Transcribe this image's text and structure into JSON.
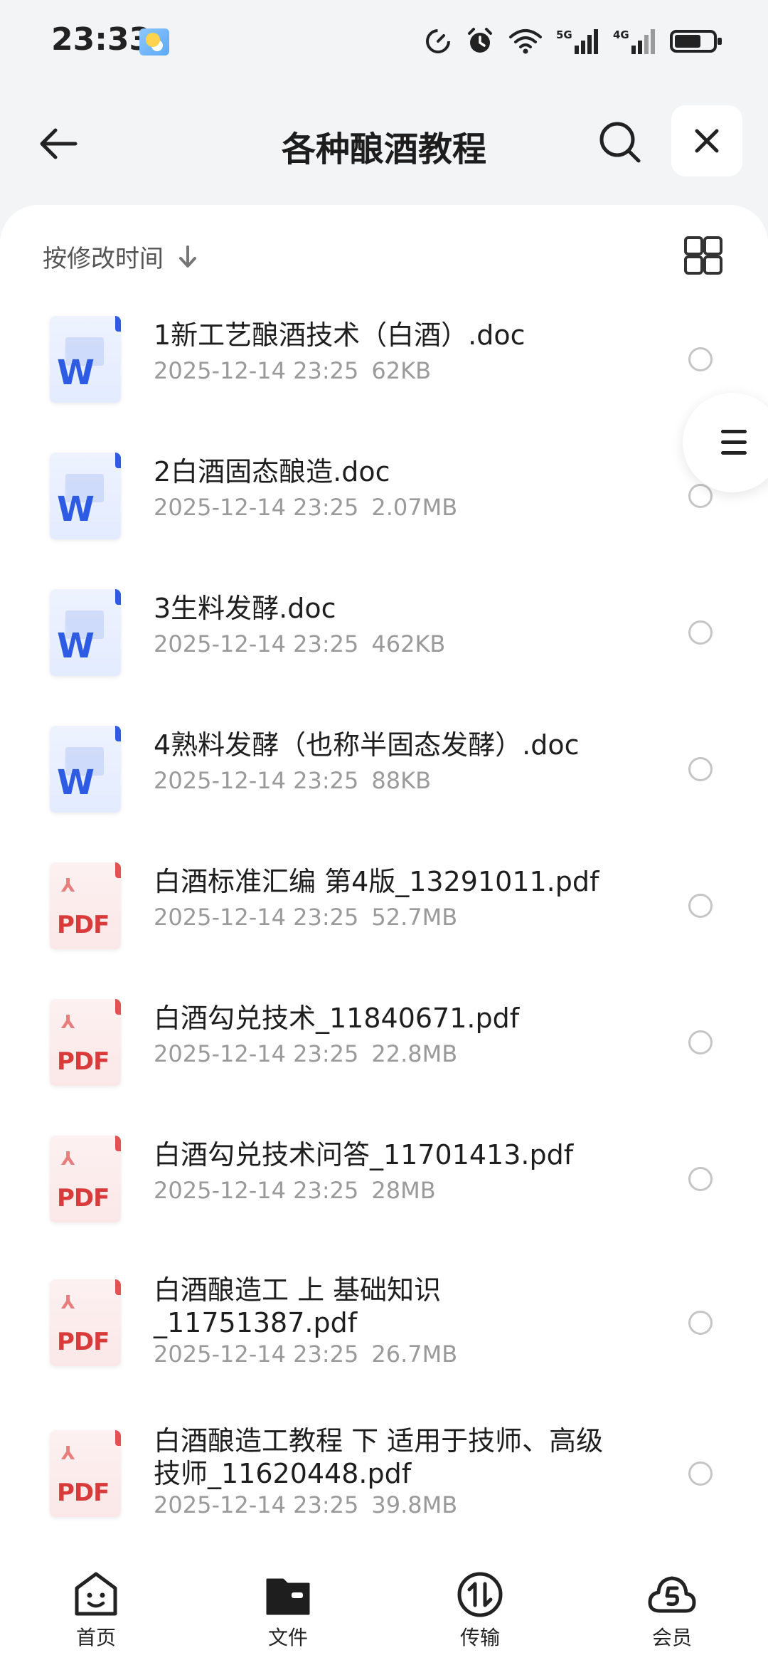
{
  "status_bar": {
    "time": "23:33",
    "icons": [
      "weather-icon",
      "speed-icon",
      "alarm-icon",
      "wifi-icon",
      "signal-5g-icon",
      "signal-4g-icon",
      "battery-icon"
    ],
    "signal_5g": "5G",
    "signal_4g": "4G"
  },
  "header": {
    "title": "各种酿酒教程",
    "back_icon": "arrow-left-icon",
    "search_icon": "search-icon",
    "close_icon": "close-icon"
  },
  "sort": {
    "label": "按修改时间",
    "direction_icon": "arrow-down-icon",
    "view_toggle_icon": "grid-view-icon"
  },
  "files": [
    {
      "type": "doc",
      "icon_label": "W",
      "name": "1新工艺酿酒技术（白酒）.doc",
      "date": "2025-12-14 23:25",
      "size": "62KB"
    },
    {
      "type": "doc",
      "icon_label": "W",
      "name": "2白酒固态酿造.doc",
      "date": "2025-12-14 23:25",
      "size": "2.07MB"
    },
    {
      "type": "doc",
      "icon_label": "W",
      "name": "3生料发酵.doc",
      "date": "2025-12-14 23:25",
      "size": "462KB"
    },
    {
      "type": "doc",
      "icon_label": "W",
      "name": "4熟料发酵（也称半固态发酵）.doc",
      "date": "2025-12-14 23:25",
      "size": "88KB"
    },
    {
      "type": "pdf",
      "icon_label": "PDF",
      "name": "白酒标准汇编  第4版_13291011.pdf",
      "date": "2025-12-14 23:25",
      "size": "52.7MB"
    },
    {
      "type": "pdf",
      "icon_label": "PDF",
      "name": "白酒勾兑技术_11840671.pdf",
      "date": "2025-12-14 23:25",
      "size": "22.8MB"
    },
    {
      "type": "pdf",
      "icon_label": "PDF",
      "name": "白酒勾兑技术问答_11701413.pdf",
      "date": "2025-12-14 23:25",
      "size": "28MB"
    },
    {
      "type": "pdf",
      "icon_label": "PDF",
      "name": "白酒酿造工  上  基础知识_11751387.pdf",
      "date": "2025-12-14 23:25",
      "size": "26.7MB"
    },
    {
      "type": "pdf",
      "icon_label": "PDF",
      "name": "白酒酿造工教程  下  适用于技师、高级技师_11620448.pdf",
      "date": "2025-12-14 23:25",
      "size": "39.8MB"
    }
  ],
  "tabbar": {
    "items": [
      {
        "label": "首页",
        "icon": "home-smile-icon"
      },
      {
        "label": "文件",
        "icon": "folder-icon"
      },
      {
        "label": "传输",
        "icon": "transfer-icon"
      },
      {
        "label": "会员",
        "icon": "vip-cloud-icon"
      }
    ]
  }
}
